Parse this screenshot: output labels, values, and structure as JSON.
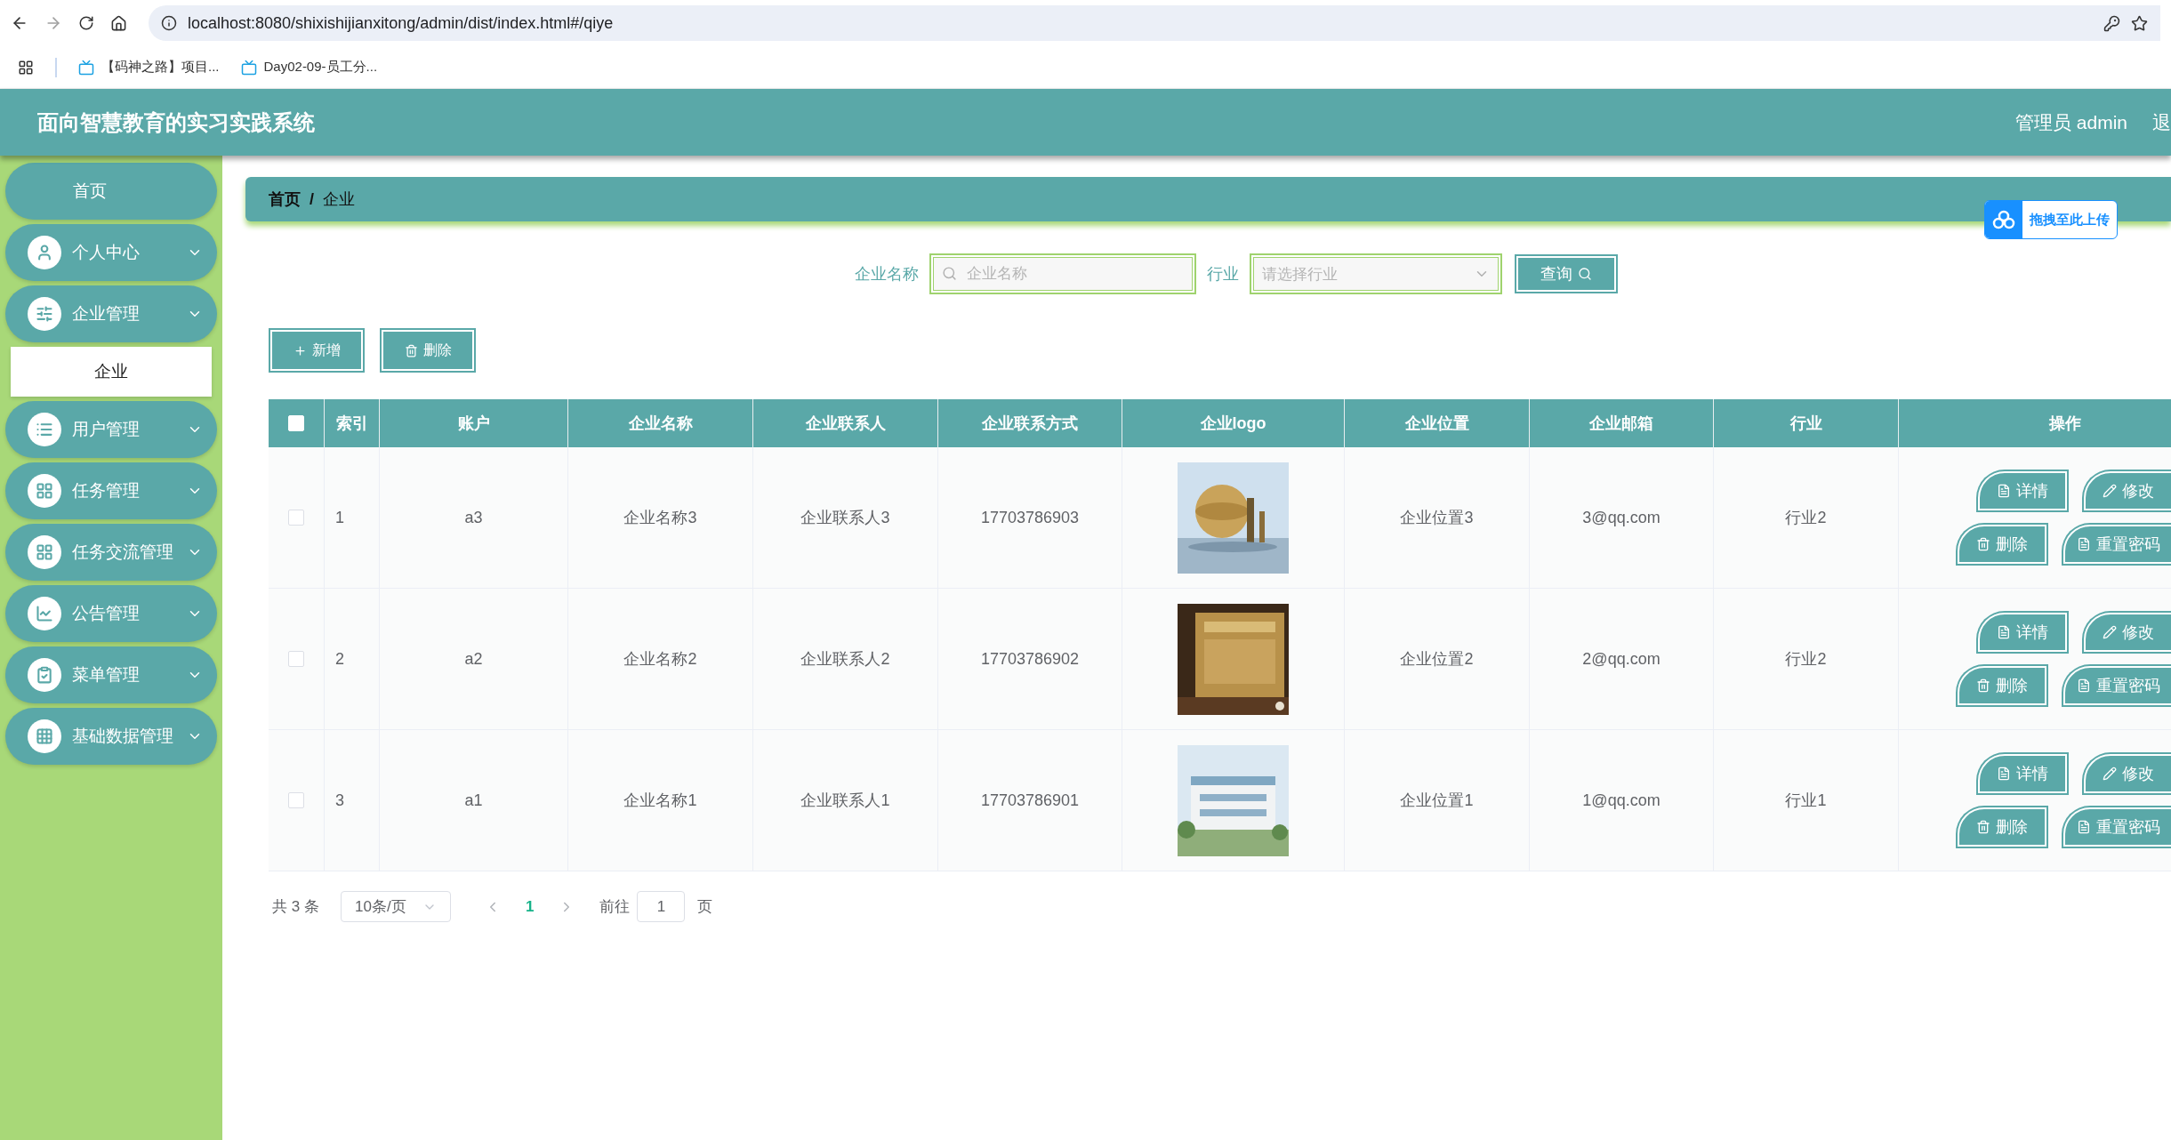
{
  "browser": {
    "url": "localhost:8080/shixishijianxitong/admin/dist/index.html#/qiye",
    "bookmarks": [
      "【码神之路】项目...",
      "Day02-09-员工分..."
    ]
  },
  "header": {
    "title": "面向智慧教育的实习实践系统",
    "user": "管理员 admin",
    "logout": "退"
  },
  "sidebar": {
    "items": [
      {
        "label": "首页",
        "kind": "link"
      },
      {
        "label": "个人中心",
        "kind": "menu"
      },
      {
        "label": "企业管理",
        "kind": "menu",
        "children": [
          {
            "label": "企业",
            "selected": true
          }
        ]
      },
      {
        "label": "用户管理",
        "kind": "menu"
      },
      {
        "label": "任务管理",
        "kind": "menu"
      },
      {
        "label": "任务交流管理",
        "kind": "menu"
      },
      {
        "label": "公告管理",
        "kind": "menu"
      },
      {
        "label": "菜单管理",
        "kind": "menu"
      },
      {
        "label": "基础数据管理",
        "kind": "menu"
      }
    ]
  },
  "breadcrumb": {
    "items": [
      "首页",
      "企业"
    ],
    "separator": "/"
  },
  "upload_badge": {
    "label": "拖拽至此上传"
  },
  "search": {
    "fields": [
      {
        "label": "企业名称",
        "placeholder": "企业名称",
        "kind": "text"
      },
      {
        "label": "行业",
        "placeholder": "请选择行业",
        "kind": "select"
      }
    ],
    "button": "查询"
  },
  "toolbar": [
    {
      "label": "新增",
      "kind": "add"
    },
    {
      "label": "删除",
      "kind": "delete"
    }
  ],
  "table": {
    "select_all": false,
    "columns": [
      "索引",
      "账户",
      "企业名称",
      "企业联系人",
      "企业联系方式",
      "企业logo",
      "企业位置",
      "企业邮箱",
      "行业",
      "操作"
    ],
    "rows": [
      {
        "checked": false,
        "cells": [
          "1",
          "a3",
          "企业名称3",
          "企业联系人3",
          "17703786903"
        ],
        "logo": {
          "kind": "picture"
        },
        "tail": [
          "企业位置3",
          "3@qq.com",
          "行业2"
        ],
        "actions": [
          {
            "label": "详情",
            "kind": "detail"
          },
          {
            "label": "修改",
            "kind": "edit"
          },
          {
            "label": "删除",
            "kind": "delete"
          },
          {
            "label": "重置密码",
            "kind": "reset"
          }
        ]
      },
      {
        "checked": false,
        "cells": [
          "2",
          "a2",
          "企业名称2",
          "企业联系人2",
          "17703786902"
        ],
        "logo": {
          "kind": "picture"
        },
        "tail": [
          "企业位置2",
          "2@qq.com",
          "行业2"
        ],
        "actions": [
          {
            "label": "详情",
            "kind": "detail"
          },
          {
            "label": "修改",
            "kind": "edit"
          },
          {
            "label": "删除",
            "kind": "delete"
          },
          {
            "label": "重置密码",
            "kind": "reset"
          }
        ]
      },
      {
        "checked": false,
        "cells": [
          "3",
          "a1",
          "企业名称1",
          "企业联系人1",
          "17703786901"
        ],
        "logo": {
          "kind": "picture"
        },
        "tail": [
          "企业位置1",
          "1@qq.com",
          "行业1"
        ],
        "actions": [
          {
            "label": "详情",
            "kind": "detail"
          },
          {
            "label": "修改",
            "kind": "edit"
          },
          {
            "label": "删除",
            "kind": "delete"
          },
          {
            "label": "重置密码",
            "kind": "reset"
          }
        ]
      }
    ]
  },
  "pagination": {
    "total": "共 3 条",
    "page_size": "10条/页",
    "pages": [
      {
        "label": "1",
        "selected": true
      }
    ],
    "goto_label": "前往",
    "goto_value": "1",
    "goto_suffix": "页"
  }
}
